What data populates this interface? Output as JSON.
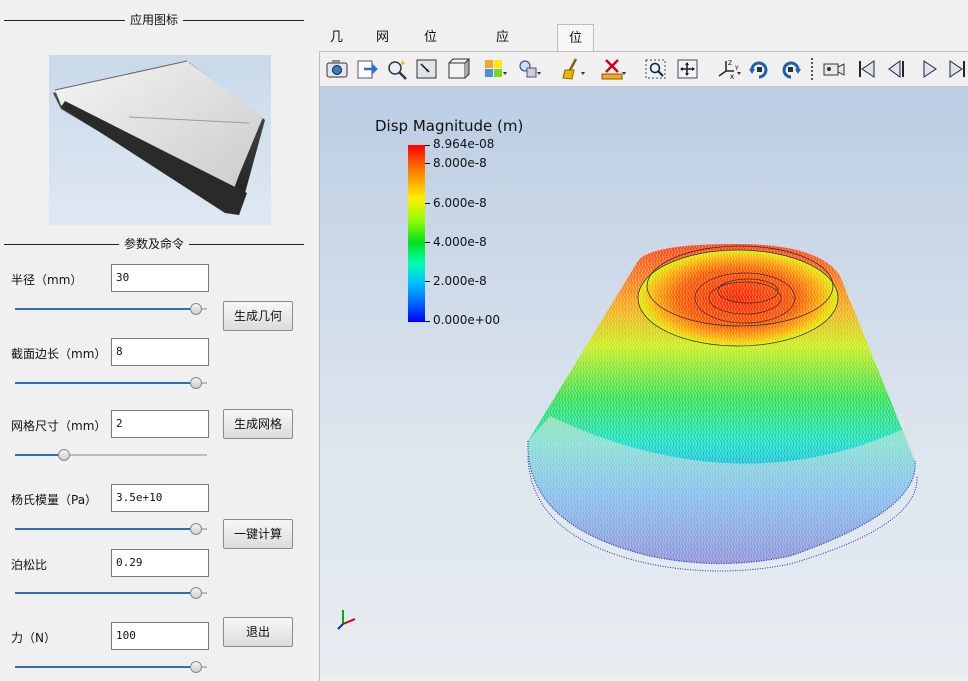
{
  "left_panel": {
    "icon_group_title": "应用图标",
    "params_group_title": "参数及命令",
    "params": [
      {
        "label": "半径（mm）",
        "value": "30",
        "slider": 0.97
      },
      {
        "label": "截面边长（mm）",
        "value": "8",
        "slider": 0.97
      },
      {
        "label": "网格尺寸（mm）",
        "value": "2",
        "slider": 0.24
      },
      {
        "label": "杨氏模量（Pa）",
        "value": "3.5e+10",
        "slider": 0.97
      },
      {
        "label": "泊松比",
        "value": "0.29",
        "slider": 0.97
      },
      {
        "label": "力（N）",
        "value": "100",
        "slider": 0.97
      }
    ],
    "buttons": {
      "gen_geometry": "生成几何",
      "gen_mesh": "生成网格",
      "compute": "一键计算",
      "exit": "退出"
    }
  },
  "tabs": [
    "几何",
    "网格",
    "位移云图",
    "应力云图",
    "位移矢量图"
  ],
  "active_tab": 4,
  "toolbar_icons": [
    "camera-icon",
    "export-icon",
    "probe-icon",
    "fit-view-icon",
    "box-view-icon",
    "color-by-icon",
    "light-icon",
    "clear-icon",
    "ruler-icon",
    "zoom-box-icon",
    "fit-all-icon",
    "axes-icon",
    "rotate-cw-icon",
    "rotate-ccw-icon",
    "record-camera-icon",
    "first-frame-icon",
    "prev-frame-icon",
    "play-icon",
    "last-frame-icon"
  ],
  "legend": {
    "title": "Disp Magnitude (m)",
    "labels": [
      "8.964e-08",
      "8.000e-8",
      "6.000e-8",
      "4.000e-8",
      "2.000e-8",
      "0.000e+00"
    ],
    "colors": {
      "max": "#ff0000",
      "min": "#0000ff"
    }
  }
}
